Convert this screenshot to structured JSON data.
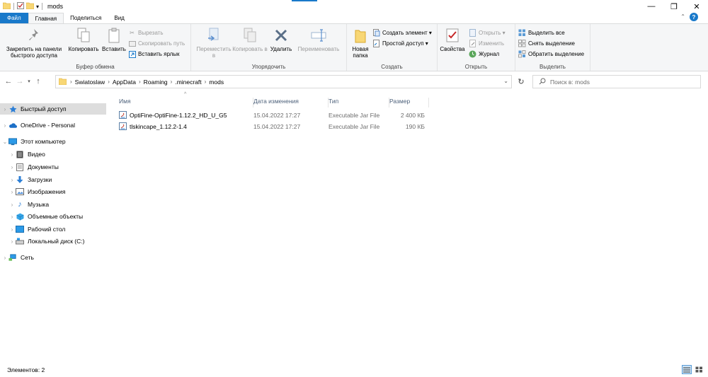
{
  "window": {
    "title": "mods",
    "minimize": "—",
    "maximize": "❐",
    "close": "✕"
  },
  "tabs": {
    "file": "Файл",
    "home": "Главная",
    "share": "Поделиться",
    "view": "Вид",
    "collapse": "⌃",
    "help": "?"
  },
  "ribbon": {
    "clipboard": {
      "label": "Буфер обмена",
      "pin": "Закрепить на панели быстрого доступа",
      "copy": "Копировать",
      "paste": "Вставить",
      "cut": "Вырезать",
      "copy_path": "Скопировать путь",
      "paste_shortcut": "Вставить ярлык"
    },
    "organize": {
      "label": "Упорядочить",
      "move": "Переместить в",
      "copy_to": "Копировать в",
      "delete": "Удалить",
      "rename": "Переименовать"
    },
    "create": {
      "label": "Создать",
      "new_folder": "Новая папка",
      "new_item": "Создать элемент ▾",
      "easy_access": "Простой доступ ▾"
    },
    "open": {
      "label": "Открыть",
      "properties": "Свойства",
      "open": "Открыть ▾",
      "edit": "Изменить",
      "history": "Журнал"
    },
    "select": {
      "label": "Выделить",
      "select_all": "Выделить все",
      "select_none": "Снять выделение",
      "invert": "Обратить выделение"
    }
  },
  "address": {
    "crumbs": [
      "Swiatoslaw",
      "AppData",
      "Roaming",
      ".minecraft",
      "mods"
    ],
    "search_placeholder": "Поиск в: mods"
  },
  "sidebar": {
    "items": [
      {
        "label": "Быстрый доступ"
      },
      {
        "label": "OneDrive - Personal"
      },
      {
        "label": "Этот компьютер"
      },
      {
        "label": "Видео"
      },
      {
        "label": "Документы"
      },
      {
        "label": "Загрузки"
      },
      {
        "label": "Изображения"
      },
      {
        "label": "Музыка"
      },
      {
        "label": "Объемные объекты"
      },
      {
        "label": "Рабочий стол"
      },
      {
        "label": "Локальный диск (C:)"
      },
      {
        "label": "Сеть"
      }
    ]
  },
  "columns": {
    "name": "Имя",
    "date": "Дата изменения",
    "type": "Тип",
    "size": "Размер"
  },
  "files": [
    {
      "name": "OptiFine-OptiFine-1.12.2_HD_U_G5",
      "date": "15.04.2022 17:27",
      "type": "Executable Jar File",
      "size": "2 400 КБ"
    },
    {
      "name": "tlskincape_1.12.2-1.4",
      "date": "15.04.2022 17:27",
      "type": "Executable Jar File",
      "size": "190 КБ"
    }
  ],
  "status": {
    "count": "Элементов: 2"
  },
  "colors": {
    "accent": "#1979ca",
    "folder": "#f8d775",
    "ribbon_bg": "#f5f6f7"
  }
}
